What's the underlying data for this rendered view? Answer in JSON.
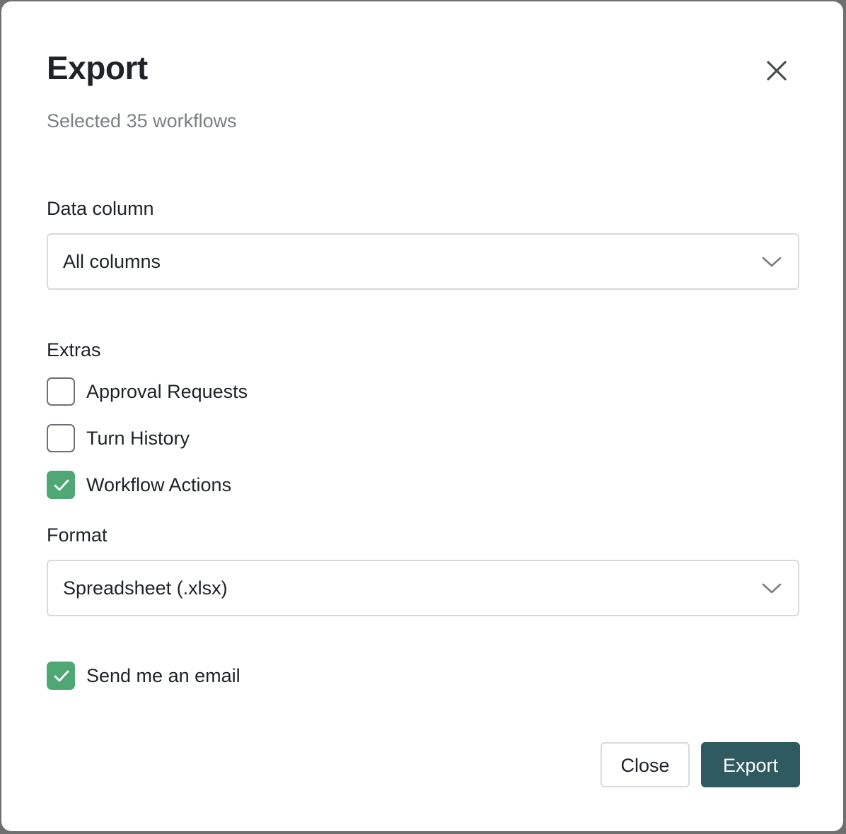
{
  "dialog": {
    "title": "Export",
    "subtitle": "Selected 35 workflows",
    "close_icon": "close-icon"
  },
  "data_column": {
    "label": "Data column",
    "selected": "All columns"
  },
  "extras": {
    "label": "Extras",
    "options": [
      {
        "label": "Approval Requests",
        "checked": false
      },
      {
        "label": "Turn History",
        "checked": false
      },
      {
        "label": "Workflow Actions",
        "checked": true
      }
    ]
  },
  "format": {
    "label": "Format",
    "selected": "Spreadsheet (.xlsx)"
  },
  "email": {
    "label": "Send me an email",
    "checked": true
  },
  "buttons": {
    "close_label": "Close",
    "export_label": "Export"
  },
  "colors": {
    "accent_checked": "#4ea774",
    "primary_button": "#2f5a5f",
    "muted_text": "#7c7f84"
  }
}
